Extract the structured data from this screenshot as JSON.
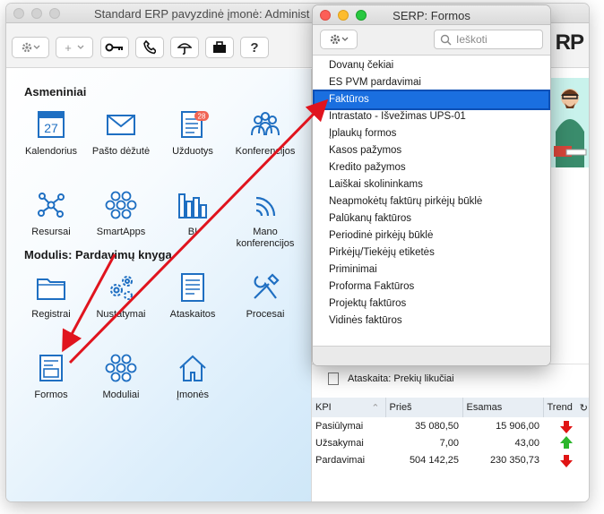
{
  "main_window": {
    "title": "Standard ERP pavyzdinė įmonė: Administ",
    "logo_text": "RP",
    "toolbar": {
      "help_label": "?",
      "plus_label": "+"
    }
  },
  "personal": {
    "title": "Asmeniniai",
    "tiles": [
      {
        "label": "Kalendorius",
        "icon": "calendar-icon",
        "day": "27"
      },
      {
        "label": "Pašto dėžutė",
        "icon": "mail-icon"
      },
      {
        "label": "Užduotys",
        "icon": "tasks-icon",
        "badge": "28"
      },
      {
        "label": "Konferencijos",
        "icon": "conferences-icon"
      },
      {
        "label": "Resursai",
        "icon": "resources-icon"
      },
      {
        "label": "SmartApps",
        "icon": "smartapps-icon"
      },
      {
        "label": "BI",
        "icon": "bi-chart-icon"
      },
      {
        "label": "Mano konferencijos",
        "icon": "wifi-icon"
      }
    ]
  },
  "module": {
    "title": "Modulis:  Pardavimų knyga",
    "tiles": [
      {
        "label": "Registrai",
        "icon": "folder-icon"
      },
      {
        "label": "Nustatymai",
        "icon": "settings-gears-icon"
      },
      {
        "label": "Ataskaitos",
        "icon": "reports-icon"
      },
      {
        "label": "Procesai",
        "icon": "tools-icon"
      },
      {
        "label": "Formos",
        "icon": "forms-icon"
      },
      {
        "label": "Moduliai",
        "icon": "modules-icon"
      },
      {
        "label": "Įmonės",
        "icon": "home-icon"
      }
    ]
  },
  "report_row": {
    "label": "Ataskaita: Prekių likučiai"
  },
  "kpi": {
    "headers": [
      "KPI",
      "Prieš",
      "Esamas",
      "Trend"
    ],
    "rows": [
      {
        "name": "Pasiūlymai",
        "before": "35 080,50",
        "current": "15 906,00",
        "trend": "down"
      },
      {
        "name": "Užsakymai",
        "before": "7,00",
        "current": "43,00",
        "trend": "up"
      },
      {
        "name": "Pardavimai",
        "before": "504 142,25",
        "current": "230 350,73",
        "trend": "down"
      }
    ]
  },
  "forms_window": {
    "title": "SERP: Formos",
    "search_placeholder": "Ieškoti",
    "items": [
      "Dovanų čekiai",
      "ES PVM pardavimai",
      "Faktūros",
      "Intrastato - Išvežimas UPS-01",
      "Įplaukų formos",
      "Kasos pažymos",
      "Kredito pažymos",
      "Laiškai skolininkams",
      "Neapmokėtų faktūrų pirkėjų būklė",
      "Palūkanų faktūros",
      "Periodinė pirkėjų būklė",
      "Pirkėjų/Tiekėjų etiketės",
      "Priminimai",
      "Proforma Faktūros",
      "Projektų faktūros",
      "Vidinės faktūros"
    ],
    "selected_index": 2
  },
  "colors": {
    "selection": "#1a6fe0",
    "annotation_arrow": "#e0141e",
    "trend_down": "#e01414",
    "trend_up": "#2bb62b",
    "icon_blue": "#1f6fc2"
  }
}
